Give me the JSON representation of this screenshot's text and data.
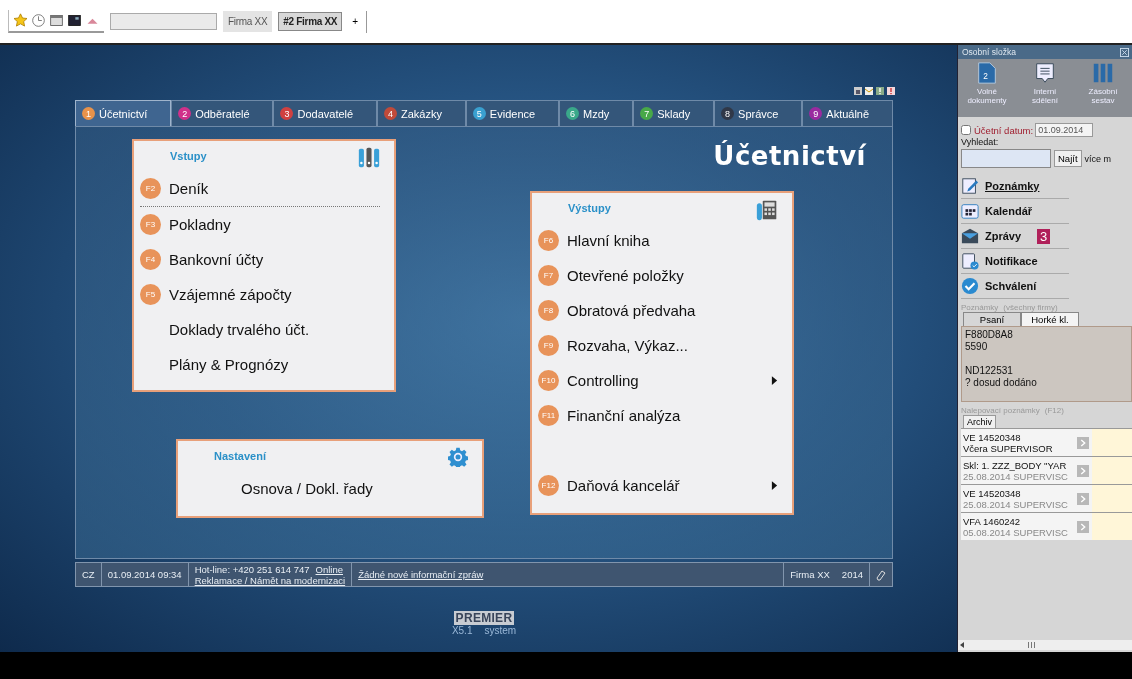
{
  "toolbar": {
    "tabs": [
      {
        "label": "Firma XX",
        "selected": false
      },
      {
        "label": "#2 Firma XX",
        "selected": true
      }
    ],
    "add_tab": "+"
  },
  "module_tabs": [
    {
      "number": "1",
      "label": "Účetnictví",
      "color": "#e8924a",
      "selected": true
    },
    {
      "number": "2",
      "label": "Odběratelé",
      "color": "#d0308a",
      "selected": false
    },
    {
      "number": "3",
      "label": "Dodavatelé",
      "color": "#d04040",
      "selected": false
    },
    {
      "number": "4",
      "label": "Zakázky",
      "color": "#c04a3a",
      "selected": false
    },
    {
      "number": "5",
      "label": "Evidence",
      "color": "#3aa0d0",
      "selected": false
    },
    {
      "number": "6",
      "label": "Mzdy",
      "color": "#3aa88a",
      "selected": false
    },
    {
      "number": "7",
      "label": "Sklady",
      "color": "#48a848",
      "selected": false
    },
    {
      "number": "8",
      "label": "Správce",
      "color": "#303848",
      "selected": false
    },
    {
      "number": "9",
      "label": "Aktuálně",
      "color": "#9a2aa0",
      "selected": false
    }
  ],
  "hub_title": "Účetnictví",
  "inputs": {
    "title": "Vstupy",
    "groups": [
      [
        {
          "key": "F2",
          "label": "Deník"
        }
      ],
      [
        {
          "key": "F3",
          "label": "Pokladny"
        },
        {
          "key": "F4",
          "label": "Bankovní účty"
        },
        {
          "key": "F5",
          "label": "Vzájemné zápočty"
        },
        {
          "label": "Doklady trvalého účt."
        },
        {
          "label": "Plány & Prognózy"
        }
      ]
    ]
  },
  "settings": {
    "title": "Nastavení",
    "items": [
      {
        "label": "Osnova / Dokl. řady"
      }
    ]
  },
  "outputs": {
    "title": "Výstupy",
    "groups": [
      [
        {
          "key": "F6",
          "label": "Hlavní kniha",
          "submenu": false
        },
        {
          "key": "F7",
          "label": "Otevřené položky",
          "submenu": false
        },
        {
          "key": "F8",
          "label": "Obratová předvaha",
          "submenu": false
        },
        {
          "key": "F9",
          "label": "Rozvaha, Výkaz...",
          "submenu": false
        },
        {
          "key": "F10",
          "label": "Controlling",
          "submenu": true
        },
        {
          "key": "F11",
          "label": "Finanční analýza",
          "submenu": false
        }
      ],
      [
        {
          "key": "F12",
          "label": "Daňová kancelář",
          "submenu": true
        }
      ]
    ]
  },
  "status_bar": {
    "language": "CZ",
    "datetime": "01.09.2014  09:34",
    "hotline": "Hot-line: +420 251 614 747",
    "online_link": "Online",
    "feedback_link": "Reklamace / Námět na modernizaci",
    "info_link": "Žádné nové informační zpráw",
    "company": "Firma XX",
    "year": "2014"
  },
  "logo": {
    "brand": "PREMIER",
    "version": "X5.1",
    "product": "system"
  },
  "side_panel": {
    "title": "Osobní složka",
    "shortcuts": [
      {
        "kind": "documents",
        "badge": "2",
        "lines": [
          "Volné",
          "dokumenty"
        ]
      },
      {
        "kind": "messages",
        "lines": [
          "Interní",
          "sdělení"
        ]
      },
      {
        "kind": "reports",
        "lines": [
          "Zásobní",
          "sestav"
        ]
      }
    ],
    "accounting_date": {
      "checked": false,
      "label": "Účetní datum:",
      "value": "01.09.2014"
    },
    "search": {
      "label": "Vyhledat:",
      "button": "Najít",
      "more": "více m"
    },
    "links": [
      {
        "kind": "notes",
        "label": "Poznámky",
        "underlined": true
      },
      {
        "kind": "calendar",
        "label": "Kalendář",
        "underlined": false
      },
      {
        "kind": "mail",
        "label": "Zprávy",
        "underlined": false,
        "badge": "3"
      },
      {
        "kind": "notify",
        "label": "Notifikace",
        "underlined": false
      },
      {
        "kind": "approve",
        "label": "Schválení",
        "underlined": false
      }
    ],
    "notes": {
      "title": "Poznámky",
      "scope": "(všechny firmy)",
      "tabs": [
        {
          "label": "Psaní",
          "selected": false
        },
        {
          "label": "Horké kl.",
          "selected": true
        }
      ],
      "text": "F880D8A8\n5590\n\nND122531\n? dosud dodáno"
    },
    "sticky": {
      "title": "Nalepovací poznámky",
      "hotkey": "(F12)",
      "tab": "Archiv",
      "items": [
        {
          "title": "VE 14520348",
          "meta": "Včera SUPERVISOR",
          "recent": true
        },
        {
          "title": "Skl: 1. ZZZ_BODY \"YAR",
          "meta": "25.08.2014 SUPERVISC",
          "recent": false
        },
        {
          "title": "VE 14520348",
          "meta": "25.08.2014 SUPERVISC",
          "recent": false
        },
        {
          "title": "VFA 1460242",
          "meta": "05.08.2014 SUPERVISC",
          "recent": false
        }
      ]
    }
  }
}
